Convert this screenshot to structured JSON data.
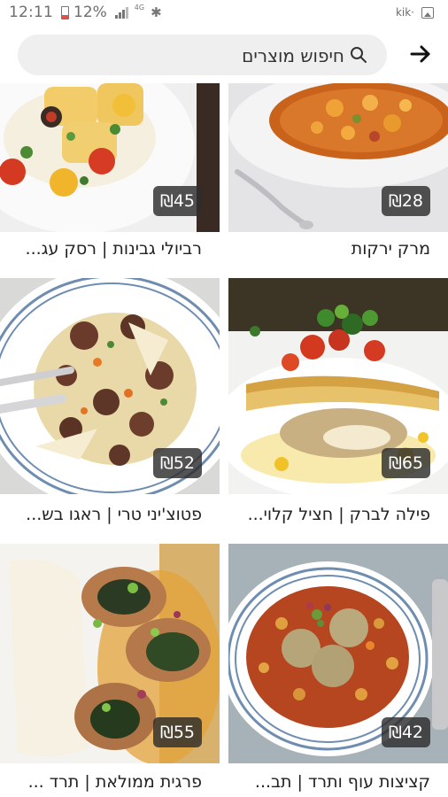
{
  "status_bar": {
    "time": "12:11",
    "battery": "12%",
    "network": "4G",
    "right_label": "kik·"
  },
  "search": {
    "label": "חיפוש מוצרים"
  },
  "products": [
    {
      "name": "מרק ירקות",
      "price": "₪28"
    },
    {
      "name": "רביולי גבינות | רסק עג...",
      "price": "₪45"
    },
    {
      "name": "פילה לברק | חציל קלוי...",
      "price": "₪65"
    },
    {
      "name": "פטוצ'יני טרי | ראגו בש...",
      "price": "₪52"
    },
    {
      "name": "קציצות עוף ותרד | תב...",
      "price": "₪42"
    },
    {
      "name": "פרגית ממולאת | תרד ...",
      "price": "₪55"
    }
  ],
  "colors": {
    "search_background": "#efefef",
    "price_badge": "#2d2d2d",
    "status_icons": "#6d6d6d"
  }
}
